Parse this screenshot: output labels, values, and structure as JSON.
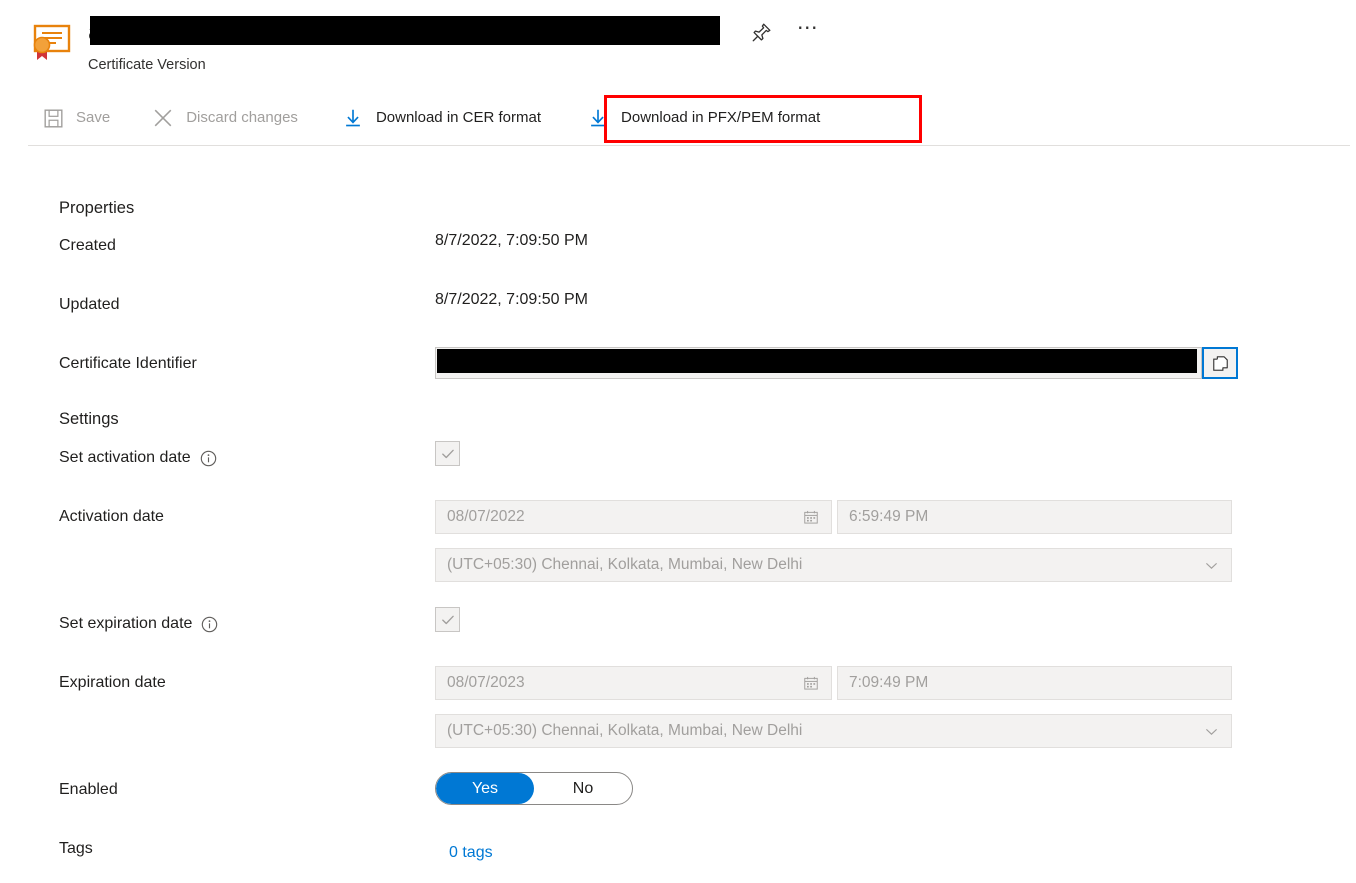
{
  "header": {
    "icon": "certificate-icon",
    "title": "a",
    "title_redacted": true,
    "subtitle": "Certificate Version",
    "pin_icon": "pin-icon",
    "more_icon": "ellipsis-icon"
  },
  "toolbar": {
    "items": [
      {
        "label": "Save",
        "icon": "save-icon",
        "enabled": false
      },
      {
        "label": "Discard changes",
        "icon": "close-x-icon",
        "enabled": false
      },
      {
        "label": "Download in CER format",
        "icon": "download-icon",
        "enabled": true
      },
      {
        "label": "Download in PFX/PEM format",
        "icon": "download-icon",
        "enabled": true,
        "highlighted": true
      }
    ],
    "highlight_color": "#ff0000"
  },
  "properties": {
    "heading": "Properties",
    "created_label": "Created",
    "created_value": "8/7/2022, 7:09:50 PM",
    "updated_label": "Updated",
    "updated_value": "8/7/2022, 7:09:50 PM",
    "identifier_label": "Certificate Identifier",
    "identifier_value": "",
    "identifier_redacted": true,
    "copy_icon": "copy-icon"
  },
  "settings": {
    "heading": "Settings",
    "set_activation_label": "Set activation date",
    "set_activation_checked": true,
    "activation_date_label": "Activation date",
    "activation_date": "08/07/2022",
    "activation_time": "6:59:49 PM",
    "activation_timezone": "(UTC+05:30) Chennai, Kolkata, Mumbai, New Delhi",
    "set_expiration_label": "Set expiration date",
    "set_expiration_checked": true,
    "expiration_date_label": "Expiration date",
    "expiration_date": "08/07/2023",
    "expiration_time": "7:09:49 PM",
    "expiration_timezone": "(UTC+05:30) Chennai, Kolkata, Mumbai, New Delhi",
    "enabled_label": "Enabled",
    "enabled_yes": "Yes",
    "enabled_no": "No",
    "enabled_value": "Yes",
    "tags_label": "Tags",
    "tags_value": "0 tags",
    "info_icon": "info-icon",
    "calendar_icon": "calendar-icon",
    "chevron_icon": "chevron-down-icon"
  },
  "colors": {
    "accent": "#0078d4",
    "highlight": "#ff0000",
    "disabled_text": "#a19f9d",
    "field_bg": "#f3f2f1"
  }
}
